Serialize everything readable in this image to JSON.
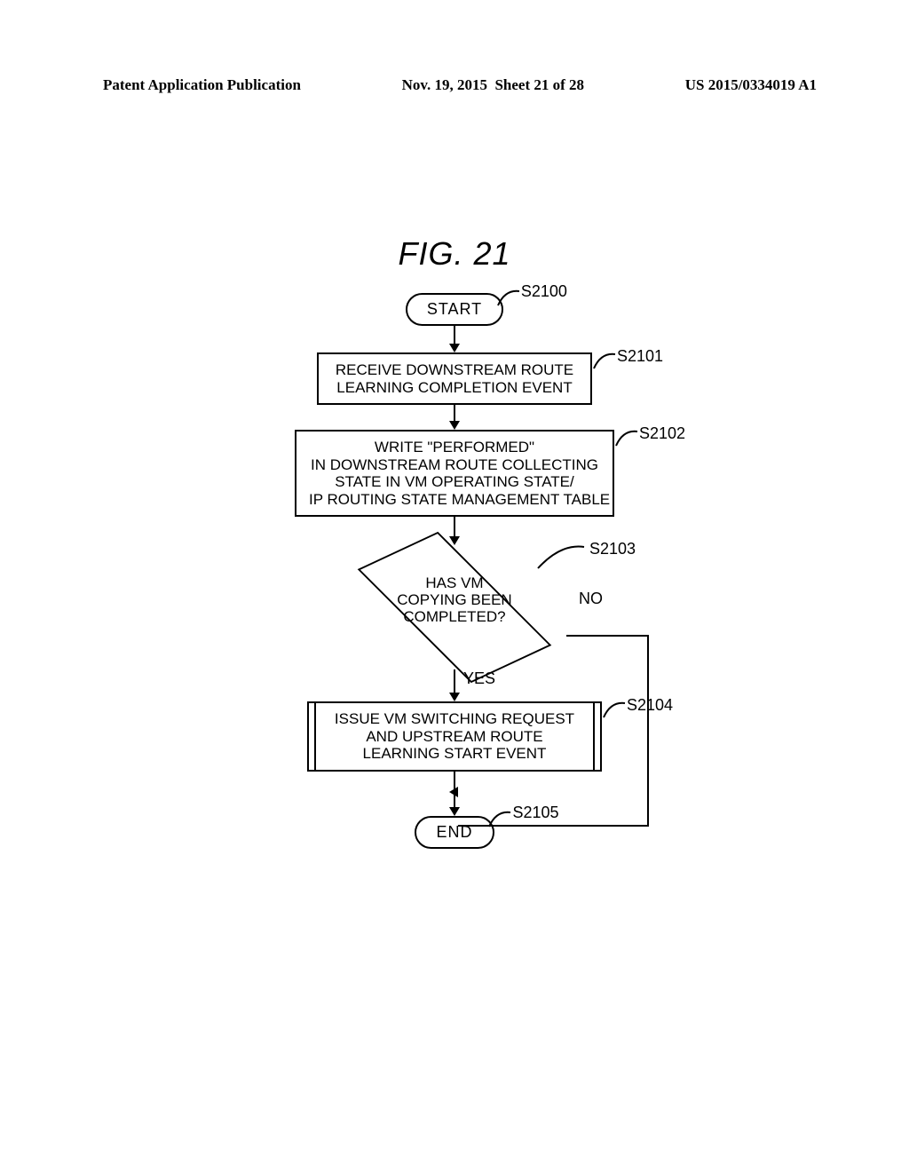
{
  "header": {
    "left": "Patent Application Publication",
    "mid": "Nov. 19, 2015  Sheet 21 of 28",
    "right": "US 2015/0334019 A1"
  },
  "figure": {
    "title": "FIG. 21"
  },
  "chart_data": {
    "type": "flowchart",
    "nodes": [
      {
        "id": "S2100",
        "kind": "terminal",
        "label": "START"
      },
      {
        "id": "S2101",
        "kind": "process",
        "label": "RECEIVE DOWNSTREAM ROUTE\nLEARNING COMPLETION EVENT"
      },
      {
        "id": "S2102",
        "kind": "process",
        "label": "WRITE \"PERFORMED\"\nIN DOWNSTREAM ROUTE COLLECTING\nSTATE IN VM OPERATING STATE/\nIP ROUTING STATE MANAGEMENT TABLE"
      },
      {
        "id": "S2103",
        "kind": "decision",
        "label": "HAS VM\nCOPYING BEEN\nCOMPLETED?"
      },
      {
        "id": "S2104",
        "kind": "subprocess",
        "label": "ISSUE VM SWITCHING REQUEST\nAND UPSTREAM ROUTE\nLEARNING START EVENT"
      },
      {
        "id": "S2105",
        "kind": "terminal",
        "label": "END"
      }
    ],
    "edges": [
      {
        "from": "S2100",
        "to": "S2101"
      },
      {
        "from": "S2101",
        "to": "S2102"
      },
      {
        "from": "S2102",
        "to": "S2103"
      },
      {
        "from": "S2103",
        "to": "S2104",
        "label": "YES"
      },
      {
        "from": "S2103",
        "to": "S2105",
        "label": "NO"
      },
      {
        "from": "S2104",
        "to": "S2105"
      }
    ]
  },
  "labels": {
    "s2100": "S2100",
    "s2101": "S2101",
    "s2102": "S2102",
    "s2103": "S2103",
    "s2104": "S2104",
    "s2105": "S2105",
    "yes": "YES",
    "no": "NO"
  }
}
